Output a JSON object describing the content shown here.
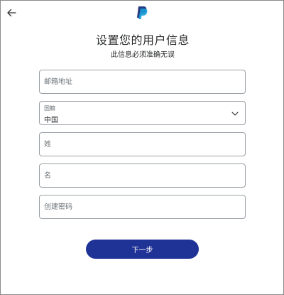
{
  "header": {
    "back_icon": "arrow-left-icon",
    "logo": "paypal-logo",
    "brand_colors": {
      "dark": "#253b80",
      "light": "#179bd7"
    }
  },
  "form": {
    "title": "设置您的用户信息",
    "subtitle": "此信息必须准确无误",
    "email": {
      "placeholder": "邮箱地址",
      "value": ""
    },
    "country": {
      "label": "国籍",
      "value": "中国",
      "icon": "chevron-down-icon"
    },
    "last_name": {
      "placeholder": "姓",
      "value": ""
    },
    "first_name": {
      "placeholder": "名",
      "value": ""
    },
    "password": {
      "placeholder": "创建密码",
      "value": ""
    },
    "next_label": "下一步"
  },
  "colors": {
    "primary_button": "#1f3296",
    "field_border": "#9aa0a6",
    "text": "#2c2e2f",
    "placeholder": "#6c7378"
  }
}
